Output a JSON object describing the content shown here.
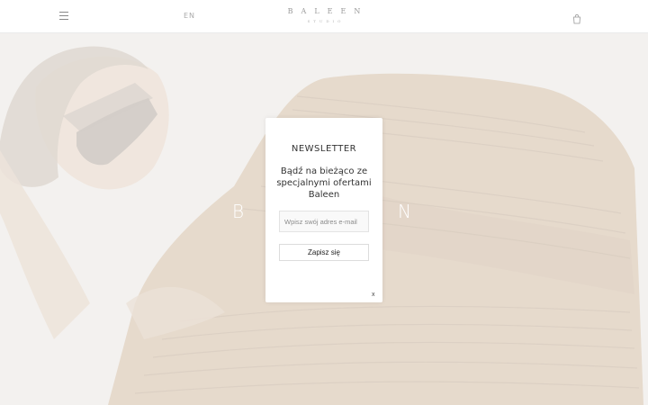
{
  "header": {
    "menu_icon": "hamburger-menu-icon",
    "language": "EN",
    "logo": {
      "main": "BALEEN",
      "sub": "STUDIO"
    },
    "cart_icon": "shopping-bag-icon"
  },
  "hero": {
    "word_left": "B",
    "word_right": "N"
  },
  "newsletter": {
    "title": "NEWSLETTER",
    "text": "Bądź na bieżąco ze specjalnymi ofertami Baleen",
    "email_placeholder": "Wpisz swój adres e-mail",
    "submit_label": "Zapisz się",
    "close_label": "x"
  }
}
